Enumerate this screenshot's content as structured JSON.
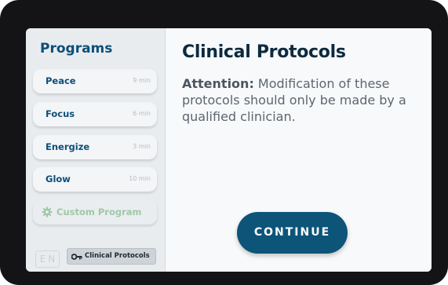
{
  "sidebar": {
    "title": "Programs",
    "programs": [
      {
        "name": "Peace",
        "duration": "9 min"
      },
      {
        "name": "Focus",
        "duration": "6 min"
      },
      {
        "name": "Energize",
        "duration": "3 min"
      },
      {
        "name": "Glow",
        "duration": "10 min"
      }
    ],
    "custom_program": {
      "label": "Custom Program",
      "icon": "gear-icon"
    },
    "language": "EN",
    "protocols_button": {
      "label": "Clinical Protocols",
      "icon": "key-icon"
    }
  },
  "main": {
    "title": "Clinical Protocols",
    "attention_label": "Attention:",
    "attention_text": " Modification of these protocols should only be made by a qualified clinician.",
    "continue_label": "CONTINUE"
  },
  "colors": {
    "accent": "#0d5479",
    "title": "#0d4f78",
    "custom_program": "#9fc8a8"
  }
}
